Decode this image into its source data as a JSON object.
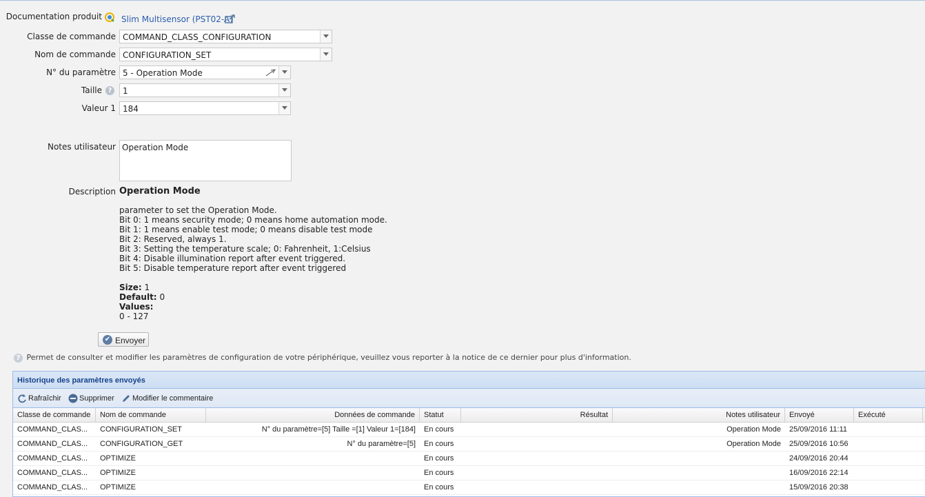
{
  "form": {
    "doc_label": "Documentation produit",
    "doc_link": "Slim Multisensor (PST02-A)",
    "class_label": "Classe de commande",
    "class_value": "COMMAND_CLASS_CONFIGURATION",
    "name_label": "Nom de commande",
    "name_value": "CONFIGURATION_SET",
    "param_label": "N° du paramètre",
    "param_value": "5 - Operation Mode",
    "size_label": "Taille",
    "size_value": "1",
    "value1_label": "Valeur 1",
    "value1_value": "184",
    "notes_label": "Notes utilisateur",
    "notes_value": "Operation Mode",
    "desc_label": "Description",
    "desc_title": "Operation Mode",
    "desc_lines": [
      "parameter to set the Operation Mode.",
      "Bit 0: 1 means security mode; 0 means home automation mode.",
      "Bit 1: 1 means enable test mode; 0 means disable test mode",
      "Bit 2: Reserved, always 1.",
      "Bit 3: Setting the temperature scale; 0: Fahrenheit, 1:Celsius",
      "Bit 4: Disable illumination report after event triggered.",
      "Bit 5: Disable temperature report after event triggered"
    ],
    "size_key": "Size:",
    "size_val": "1",
    "default_key": "Default:",
    "default_val": "0",
    "values_key": "Values:",
    "values_range": "0 - 127",
    "send_label": "Envoyer"
  },
  "info_text": "Permet de consulter et modifier les paramètres de configuration de votre périphérique, veuillez vous reporter à la notice de ce dernier pour plus d'information.",
  "history": {
    "title": "Historique des paramètres envoyés",
    "toolbar": {
      "refresh": "Rafraîchir",
      "delete": "Supprimer",
      "edit_comment": "Modifier le commentaire"
    },
    "columns": [
      "Classe de commande",
      "Nom de commande",
      "Données de commande",
      "Statut",
      "Résultat",
      "Notes utilisateur",
      "Envoyé",
      "Exécuté"
    ],
    "rows": [
      [
        "COMMAND_CLAS...",
        "CONFIGURATION_SET",
        "N° du paramètre=[5] Taille =[1] Valeur 1=[184]",
        "En cours",
        "",
        "Operation Mode",
        "25/09/2016 11:11",
        ""
      ],
      [
        "COMMAND_CLAS...",
        "CONFIGURATION_GET",
        "N° du paramètre=[5]",
        "En cours",
        "",
        "Operation Mode",
        "25/09/2016 10:56",
        ""
      ],
      [
        "COMMAND_CLAS...",
        "OPTIMIZE",
        "",
        "En cours",
        "",
        "",
        "24/09/2016 20:44",
        ""
      ],
      [
        "COMMAND_CLAS...",
        "OPTIMIZE",
        "",
        "En cours",
        "",
        "",
        "16/09/2016 22:14",
        ""
      ],
      [
        "COMMAND_CLAS...",
        "OPTIMIZE",
        "",
        "En cours",
        "",
        "",
        "15/09/2016 20:38",
        ""
      ]
    ]
  },
  "colors": {
    "link": "#2a5db0",
    "panel_title": "#15428b",
    "panel_border": "#99bbe8"
  }
}
